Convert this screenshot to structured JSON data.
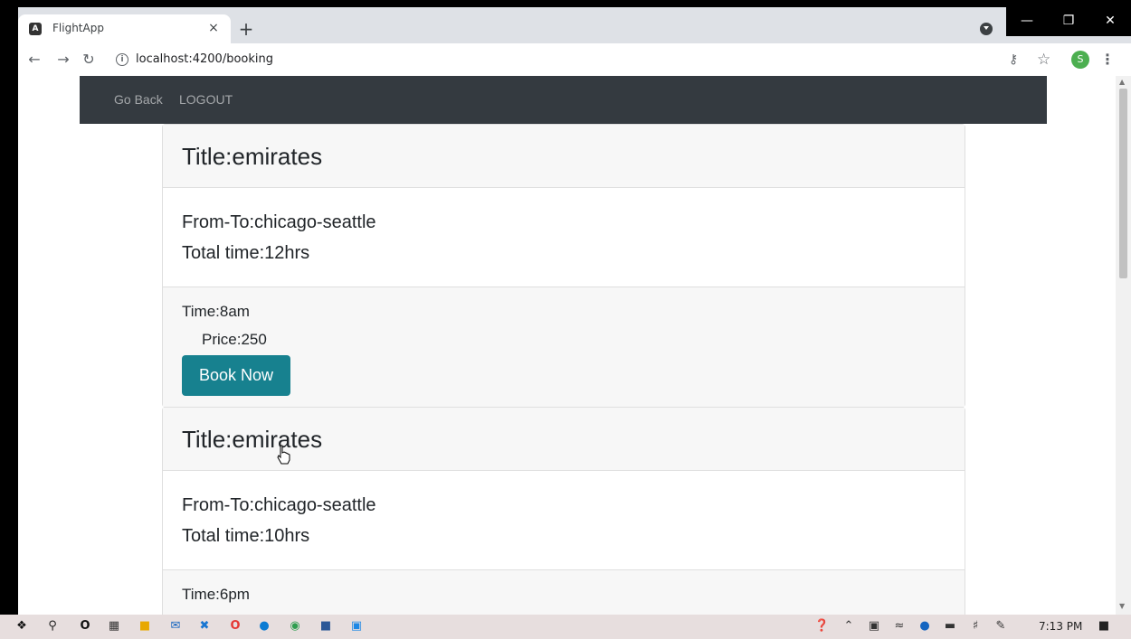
{
  "browser": {
    "tab_title": "FlightApp",
    "tab_close": "×",
    "new_tab": "+",
    "url": "localhost:4200/booking",
    "profile_initial": "S"
  },
  "navbar": {
    "go_back": "Go Back",
    "logout": "LOGOUT"
  },
  "flights": [
    {
      "title": "Title:emirates",
      "from_to": "From-To:chicago-seattle",
      "total_time": "Total time:12hrs",
      "time": "Time:8am",
      "price": "Price:250",
      "button": "Book Now"
    },
    {
      "title": "Title:emirates",
      "from_to": "From-To:chicago-seattle",
      "total_time": "Total time:10hrs",
      "time": "Time:6pm"
    }
  ],
  "taskbar": {
    "clock": "7:13 PM"
  },
  "colors": {
    "navbar_bg": "#343a40",
    "button_bg": "#17818f",
    "card_header_bg": "#f7f7f7"
  }
}
